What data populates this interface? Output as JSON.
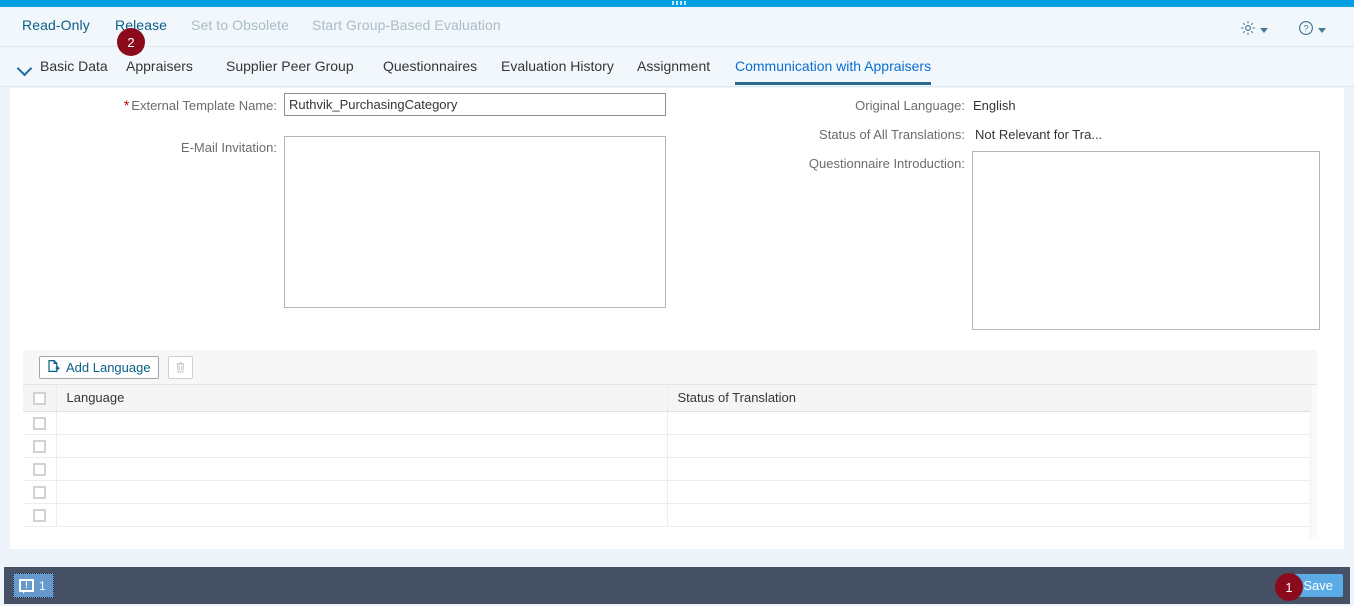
{
  "window": {
    "drag_handle": "drag-handle"
  },
  "action_bar": {
    "buttons": [
      {
        "label": "Read-Only",
        "enabled": true
      },
      {
        "label": "Release",
        "enabled": true
      },
      {
        "label": "Set to Obsolete",
        "enabled": false
      },
      {
        "label": "Start Group-Based Evaluation",
        "enabled": false
      }
    ],
    "settings_icon": "gear-icon",
    "help_icon": "question-mark-icon"
  },
  "tabs": [
    {
      "label": "Basic Data",
      "selected": false
    },
    {
      "label": "Appraisers",
      "selected": false
    },
    {
      "label": "Supplier Peer Group",
      "selected": false
    },
    {
      "label": "Questionnaires",
      "selected": false
    },
    {
      "label": "Evaluation History",
      "selected": false
    },
    {
      "label": "Assignment",
      "selected": false
    },
    {
      "label": "Communication with Appraisers",
      "selected": true
    }
  ],
  "form": {
    "external_template_name": {
      "label": "External Template Name:",
      "required": true,
      "value": "Ruthvik_PurchasingCategory",
      "placeholder": ""
    },
    "email_invitation": {
      "label": "E-Mail Invitation:",
      "value": "",
      "placeholder": ""
    },
    "original_language": {
      "label": "Original Language:",
      "value": "English"
    },
    "status_of_all_translations": {
      "label": "Status of All Translations:",
      "value": "Not Relevant for Tra..."
    },
    "questionnaire_introduction": {
      "label": "Questionnaire Introduction:",
      "value": "",
      "placeholder": ""
    }
  },
  "table": {
    "toolbar": {
      "add_language_label": "Add Language",
      "add_icon": "add-document-icon",
      "delete_icon": "trash-icon"
    },
    "columns": [
      {
        "key": "language",
        "label": "Language"
      },
      {
        "key": "status",
        "label": "Status of Translation"
      }
    ],
    "rows": [
      {
        "language": "",
        "status": ""
      },
      {
        "language": "",
        "status": ""
      },
      {
        "language": "",
        "status": ""
      },
      {
        "language": "",
        "status": ""
      },
      {
        "language": "",
        "status": ""
      }
    ]
  },
  "footer": {
    "message_count": "1",
    "message_icon": "message-alert-icon",
    "save_label": "Save"
  },
  "markers": {
    "save_marker": "1",
    "release_marker": "2"
  },
  "colors": {
    "accent_blue": "#0a6ed1",
    "drag_strip": "#00a0e3",
    "marker_red": "#8b0b1c",
    "footer_bg": "#465165",
    "save_blue": "#5aabe6"
  }
}
